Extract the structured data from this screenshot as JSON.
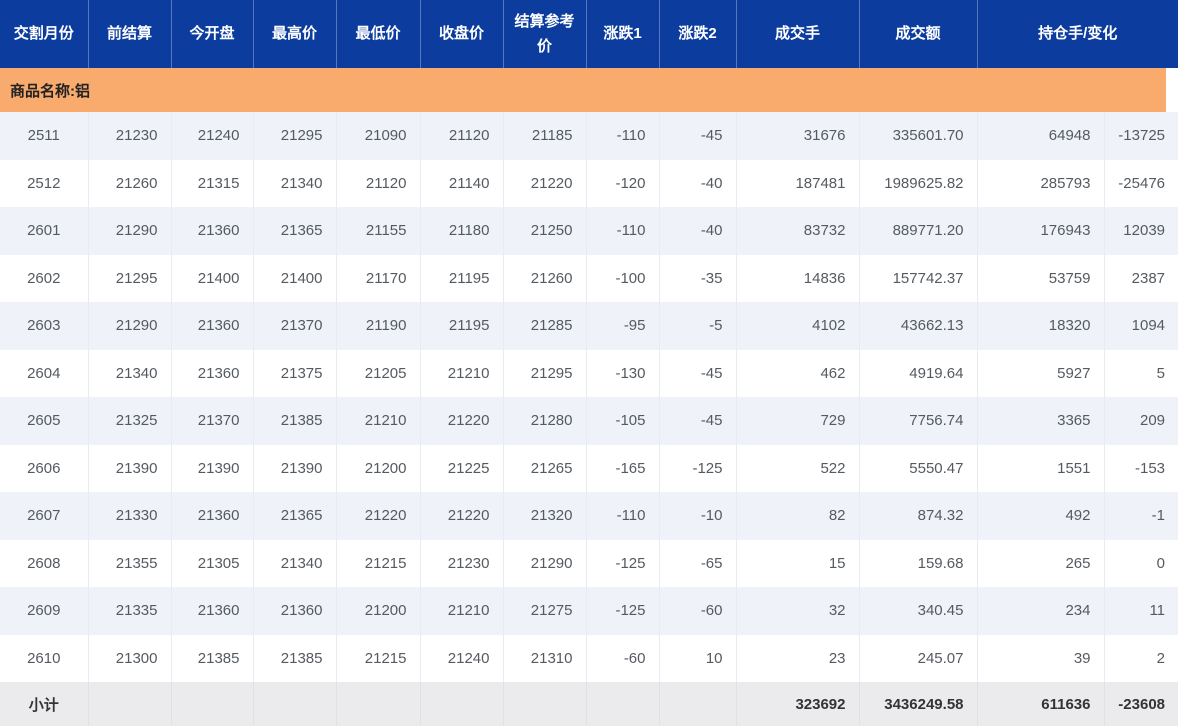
{
  "banner": {
    "label": "商品名称:铝"
  },
  "table": {
    "headers": [
      "交割月份",
      "前结算",
      "今开盘",
      "最高价",
      "最低价",
      "收盘价",
      "结算参考价",
      "涨跌1",
      "涨跌2",
      "成交手",
      "成交额",
      "持仓手/变化"
    ],
    "rows": [
      {
        "cells": [
          "2511",
          "21230",
          "21240",
          "21295",
          "21090",
          "21120",
          "21185",
          "-110",
          "-45",
          "31676",
          "335601.70",
          "64948",
          "-13725"
        ]
      },
      {
        "cells": [
          "2512",
          "21260",
          "21315",
          "21340",
          "21120",
          "21140",
          "21220",
          "-120",
          "-40",
          "187481",
          "1989625.82",
          "285793",
          "-25476"
        ]
      },
      {
        "cells": [
          "2601",
          "21290",
          "21360",
          "21365",
          "21155",
          "21180",
          "21250",
          "-110",
          "-40",
          "83732",
          "889771.20",
          "176943",
          "12039"
        ]
      },
      {
        "cells": [
          "2602",
          "21295",
          "21400",
          "21400",
          "21170",
          "21195",
          "21260",
          "-100",
          "-35",
          "14836",
          "157742.37",
          "53759",
          "2387"
        ]
      },
      {
        "cells": [
          "2603",
          "21290",
          "21360",
          "21370",
          "21190",
          "21195",
          "21285",
          "-95",
          "-5",
          "4102",
          "43662.13",
          "18320",
          "1094"
        ]
      },
      {
        "cells": [
          "2604",
          "21340",
          "21360",
          "21375",
          "21205",
          "21210",
          "21295",
          "-130",
          "-45",
          "462",
          "4919.64",
          "5927",
          "5"
        ]
      },
      {
        "cells": [
          "2605",
          "21325",
          "21370",
          "21385",
          "21210",
          "21220",
          "21280",
          "-105",
          "-45",
          "729",
          "7756.74",
          "3365",
          "209"
        ]
      },
      {
        "cells": [
          "2606",
          "21390",
          "21390",
          "21390",
          "21200",
          "21225",
          "21265",
          "-165",
          "-125",
          "522",
          "5550.47",
          "1551",
          "-153"
        ]
      },
      {
        "cells": [
          "2607",
          "21330",
          "21360",
          "21365",
          "21220",
          "21220",
          "21320",
          "-110",
          "-10",
          "82",
          "874.32",
          "492",
          "-1"
        ]
      },
      {
        "cells": [
          "2608",
          "21355",
          "21305",
          "21340",
          "21215",
          "21230",
          "21290",
          "-125",
          "-65",
          "15",
          "159.68",
          "265",
          "0"
        ]
      },
      {
        "cells": [
          "2609",
          "21335",
          "21360",
          "21360",
          "21200",
          "21210",
          "21275",
          "-125",
          "-60",
          "32",
          "340.45",
          "234",
          "11"
        ]
      },
      {
        "cells": [
          "2610",
          "21300",
          "21385",
          "21385",
          "21215",
          "21240",
          "21310",
          "-60",
          "10",
          "23",
          "245.07",
          "39",
          "2"
        ]
      }
    ],
    "subtotal": {
      "cells": [
        "小计",
        "",
        "",
        "",
        "",
        "",
        "",
        "",
        "",
        "323692",
        "3436249.58",
        "611636",
        "-23608"
      ]
    }
  },
  "colors": {
    "header_bg": "#0c3d9e",
    "header_text": "#ffffff",
    "banner_bg": "#f9ab6d",
    "stripe_row_bg": "#eff3f9",
    "subtotal_bg": "#ebebee",
    "body_text": "#555a60"
  }
}
